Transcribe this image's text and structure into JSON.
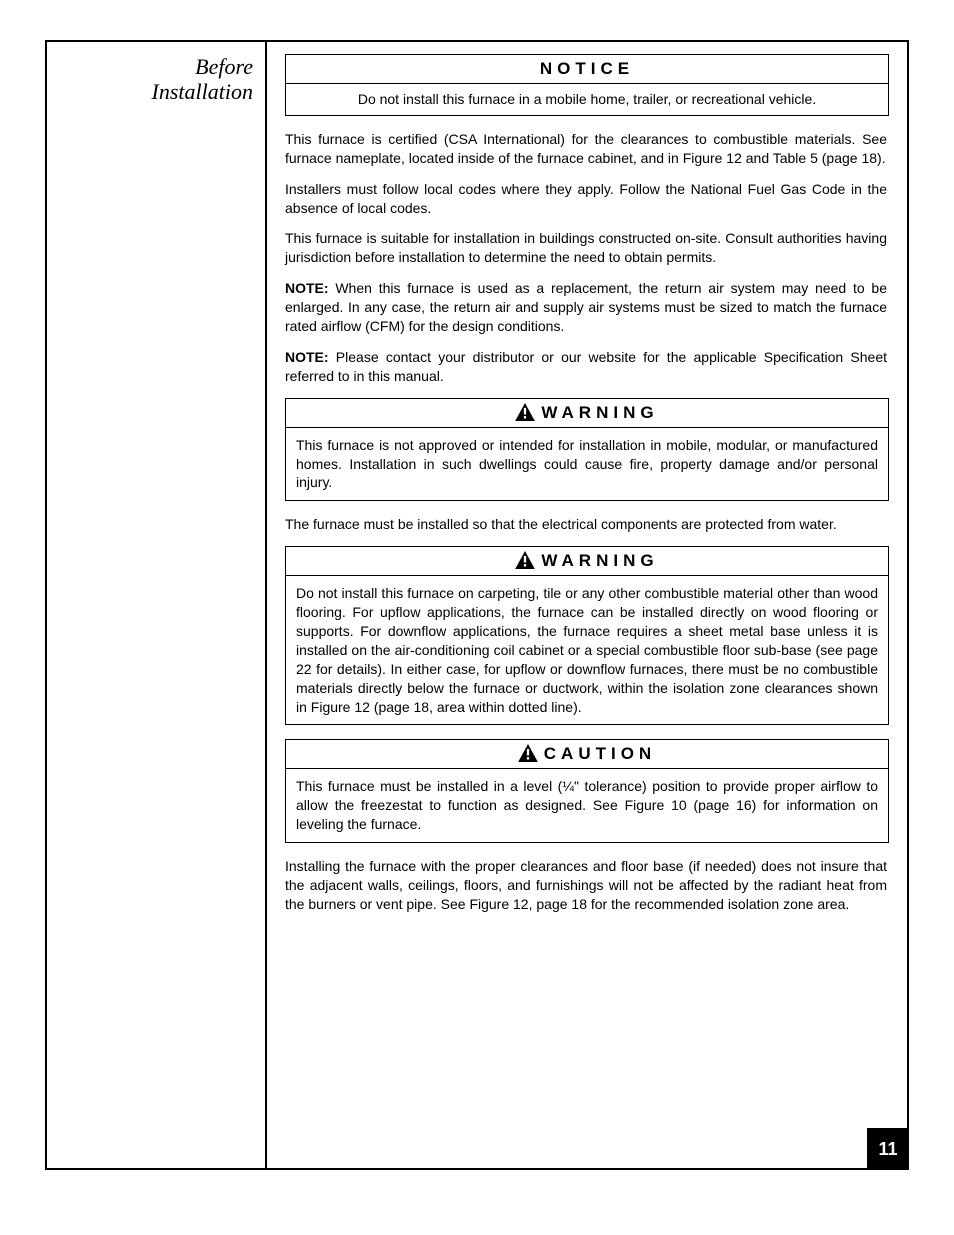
{
  "sidebar": {
    "title_line1": "Before",
    "title_line2": "Installation"
  },
  "notice1": {
    "header": "NOTICE",
    "body": "Do not install this furnace in a mobile home, trailer, or recreational vehicle."
  },
  "para1": "This furnace is certified (CSA International) for the clearances to combustible materials. See furnace nameplate, located inside of the furnace cabinet, and in Figure 12 and Table 5 (page 18).",
  "para2": "Installers must follow local codes where they apply. Follow the National Fuel Gas Code in the absence of local codes.",
  "para3": "This furnace is suitable for installation in buildings constructed on-site. Consult authorities having jurisdiction before installation to determine the need to obtain permits.",
  "note1_label": "NOTE: ",
  "note1_text": "When this furnace is used as a replacement, the return air system may need to be enlarged. In any case, the return air and supply air systems must be sized to match the furnace rated airflow (CFM) for the design conditions.",
  "note2_label": "NOTE: ",
  "note2_text": "Please contact your distributor or our website for the applicable Specification Sheet referred to in this manual.",
  "warning1": {
    "header": "WARNING",
    "body": "This furnace is not approved or intended for installation in mobile, modular, or manufactured homes. Installation in such dwellings could cause fire, property damage and/or personal injury."
  },
  "mid_text": "The furnace must be installed so that the electrical components are protected from water.",
  "warning2": {
    "header": "WARNING",
    "body": "Do not install this furnace on carpeting, tile or any other combustible material other than wood flooring. For upflow applications, the furnace can be installed directly on wood flooring or supports. For downflow applications, the furnace requires a sheet metal base unless it is installed on the air-conditioning coil cabinet or a special combustible floor sub-base (see page 22 for details). In either case, for upflow or downflow furnaces, there must be no combustible materials directly below the furnace or ductwork, within the isolation zone clearances shown in Figure 12 (page 18, area within dotted line)."
  },
  "caution1": {
    "header": "CAUTION",
    "body": "This furnace must be installed in a level (¼\" tolerance) position to provide proper airflow to allow the freezestat to function as designed. See Figure 10 (page 16) for information on leveling the furnace."
  },
  "closing_text": "Installing the furnace with the proper clearances and floor base (if needed) does not insure that the adjacent walls, ceilings, floors, and furnishings will not be affected by the radiant heat from the burners or vent pipe. See Figure 12, page 18 for the recommended isolation zone area.",
  "page_number": "11"
}
